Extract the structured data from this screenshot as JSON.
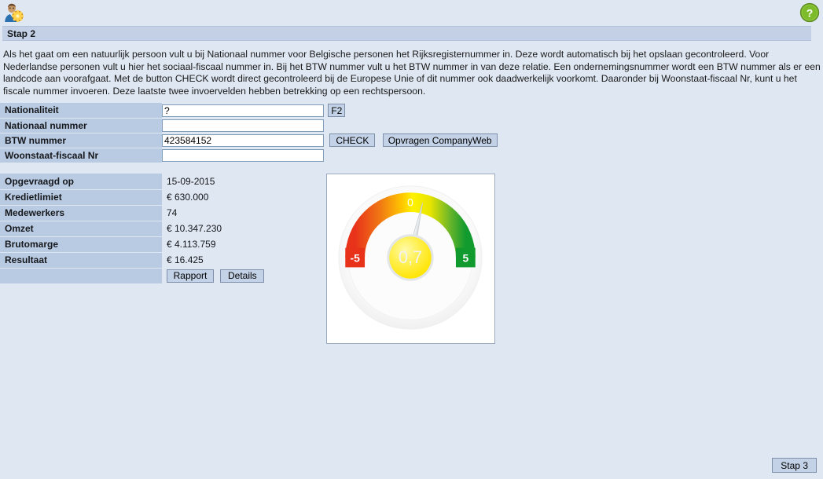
{
  "window": {
    "step_title": "Stap 2"
  },
  "icons": {
    "user_icon": "user-settings-icon",
    "help_icon": "help-question-icon"
  },
  "intro": {
    "text": "Als het gaat om een natuurlijk persoon vult u bij Nationaal nummer voor Belgische personen het Rijksregisternummer in. Deze wordt automatisch bij het opslaan gecontroleerd. Voor Nederlandse personen vult u hier het sociaal-fiscaal nummer in. Bij het BTW nummer vult u het BTW nummer in van deze relatie. Een ondernemingsnummer wordt een BTW nummer als er een landcode aan voorafgaat. Met de button CHECK wordt direct gecontroleerd bij de Europese Unie of dit nummer ook daadwerkelijk voorkomt. Daaronder bij Woonstaat-fiscaal Nr, kunt u het fiscale nummer invoeren. Deze laatste twee invoervelden hebben betrekking op een rechtspersoon."
  },
  "form": {
    "rows": [
      {
        "label": "Nationaliteit",
        "value": "?"
      },
      {
        "label": "Nationaal nummer",
        "value": ""
      },
      {
        "label": "BTW nummer",
        "value": "423584152"
      },
      {
        "label": "Woonstaat-fiscaal Nr",
        "value": ""
      }
    ],
    "f2_button": "F2",
    "check_button": "CHECK",
    "companyweb_button": "Opvragen CompanyWeb"
  },
  "details": {
    "rows": [
      {
        "label": "Opgevraagd op",
        "value": "15-09-2015"
      },
      {
        "label": "Kredietlimiet",
        "value": "€ 630.000"
      },
      {
        "label": "Medewerkers",
        "value": "74"
      },
      {
        "label": "Omzet",
        "value": "€ 10.347.230"
      },
      {
        "label": "Brutomarge",
        "value": "€ 4.113.759"
      },
      {
        "label": "Resultaat",
        "value": "€ 16.425"
      }
    ],
    "rapport_button": "Rapport",
    "details_button": "Details"
  },
  "footer": {
    "next_button": "Stap 3"
  },
  "chart_data": {
    "type": "gauge",
    "title": "",
    "value": 0.7,
    "value_label": "0,7",
    "min": -5,
    "max": 5,
    "tick_labels": [
      "-5",
      "0",
      "5"
    ],
    "tick_values": [
      -5,
      0,
      5
    ],
    "start_angle_deg": 180,
    "end_angle_deg": 360,
    "colors": {
      "low": "#e8321a",
      "mid": "#ffe800",
      "high": "#119a2e",
      "hub": "#ffe92b",
      "needle": "#d9dde0",
      "dial_face": "#fbfbfb"
    },
    "xlabel": "",
    "ylabel": "",
    "legend": []
  }
}
